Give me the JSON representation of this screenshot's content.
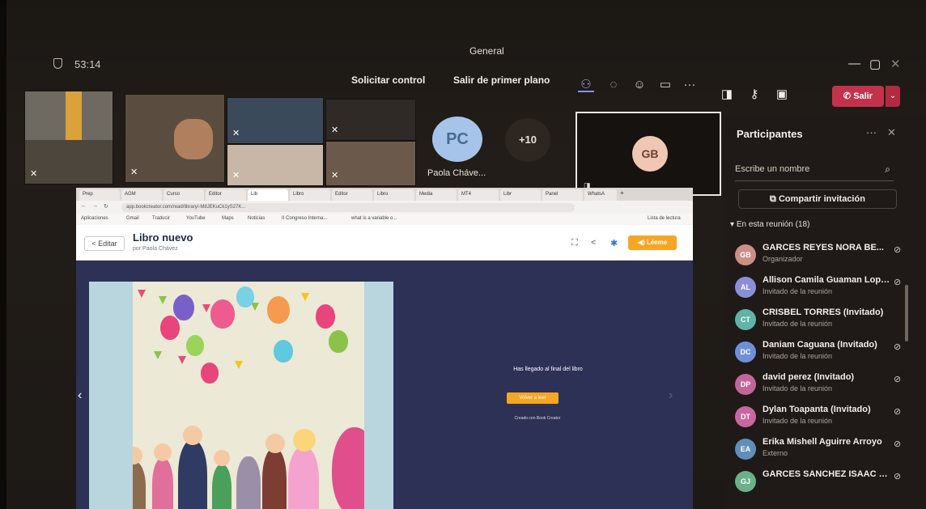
{
  "window": {
    "title": "General",
    "timer": "53:14",
    "controls": [
      "—",
      "▢",
      "✕"
    ]
  },
  "toolbar": {
    "request_control": "Solicitar control",
    "exit_foreground": "Salir de primer plano",
    "more": "···",
    "leave": "Salir",
    "icons": [
      "people-icon",
      "chat-icon",
      "reactions-icon",
      "rooms-icon"
    ]
  },
  "stage": {
    "pc_initials": "PC",
    "pc_name": "Paola Cháve...",
    "more_count": "+10",
    "gb_initials": "GB"
  },
  "panel": {
    "title": "Participantes",
    "search_placeholder": "Escribe un nombre",
    "invite": "Compartir invitación",
    "section": "En esta reunión (18)",
    "participants": [
      {
        "initials": "GB",
        "name": "GARCES REYES NORA BE...",
        "role": "Organizador",
        "color": "#cc8f86"
      },
      {
        "initials": "AL",
        "name": "Allison Camila Guaman Lopez...",
        "role": "Invitado de la reunión",
        "color": "#8a8fd6"
      },
      {
        "initials": "CT",
        "name": "CRISBEL TORRES (Invitado)",
        "role": "Invitado de la reunión",
        "color": "#5fb3a8"
      },
      {
        "initials": "DC",
        "name": "Daniam Caguana (Invitado)",
        "role": "Invitado de la reunión",
        "color": "#6f90d8"
      },
      {
        "initials": "DP",
        "name": "david perez (Invitado)",
        "role": "Invitado de la reunión",
        "color": "#c2669a"
      },
      {
        "initials": "DT",
        "name": "Dylan Toapanta (Invitado)",
        "role": "Invitado de la reunión",
        "color": "#c9669e"
      },
      {
        "initials": "EA",
        "name": "Erika Mishell Aguirre Arroyo",
        "role": "Externo",
        "color": "#5f8fb8"
      },
      {
        "initials": "GJ",
        "name": "GARCES SANCHEZ ISAAC JAH...",
        "role": "",
        "color": "#6cb08a"
      }
    ]
  },
  "browser": {
    "tabs": [
      "Prep",
      "AGM",
      "Curso",
      "Editor",
      "Lib",
      "Libro",
      "Editor",
      "Libro",
      "Media",
      "MT4",
      "Libr",
      "Panel",
      "WhatsA"
    ],
    "url": "app.bookcreator.com/read/library/-M8JEKuCk1yS27K...",
    "bookmarks": [
      "Aplicaciones",
      "Gmail",
      "Traducir",
      "YouTube",
      "Maps",
      "Noticias",
      "II Congreso Interna...",
      "what is a variable o..."
    ],
    "reading_list": "Lista de lectura",
    "back": "< Editar",
    "book_title": "Libro nuevo",
    "book_author": "por Paola Chávez",
    "read_to_me": "Léeme",
    "end_message": "Has llegado al final del libro",
    "reread": "Volver a leer",
    "created_with": "Creado con Book Creator"
  }
}
